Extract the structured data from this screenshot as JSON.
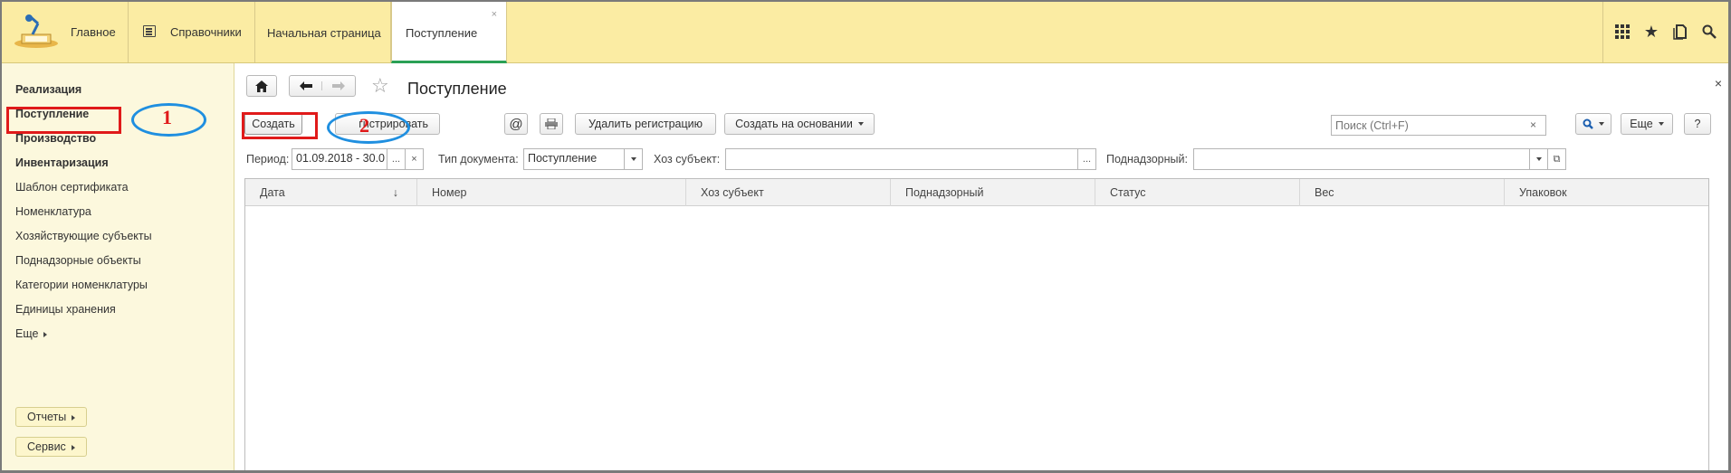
{
  "topbar": {
    "home_label": "Главное",
    "references_label": "Справочники",
    "tabs": [
      {
        "label": "Начальная страница"
      },
      {
        "label": "Поступление",
        "close": "×"
      }
    ]
  },
  "sidebar": {
    "items": [
      {
        "label": "Реализация"
      },
      {
        "label": "Поступление"
      },
      {
        "label": "Производство"
      },
      {
        "label": "Инвентаризация"
      },
      {
        "label": "Шаблон сертификата"
      },
      {
        "label": "Номенклатура"
      },
      {
        "label": "Хозяйствующие субъекты"
      },
      {
        "label": "Поднадзорные объекты"
      },
      {
        "label": "Категории номенклатуры"
      },
      {
        "label": "Единицы хранения"
      },
      {
        "label": "Еще"
      }
    ],
    "reports_label": "Отчеты",
    "service_label": "Сервис"
  },
  "annotations": {
    "one": "1",
    "two": "2"
  },
  "form": {
    "title": "Поступление",
    "close": "×",
    "toolbar": {
      "create": "Создать",
      "register": "гистрировать",
      "email": "@",
      "delete_registration": "Удалить регистрацию",
      "create_based_on": "Создать на основании",
      "search_placeholder": "Поиск (Ctrl+F)",
      "more": "Еще",
      "help": "?"
    },
    "filters": {
      "period_label": "Период:",
      "period_value": "01.09.2018 - 30.0",
      "doc_type_label": "Тип документа:",
      "doc_type_value": "Поступление",
      "subject_label": "Хоз субъект:",
      "subject_value": "",
      "supervised_label": "Поднадзорный:",
      "supervised_value": ""
    },
    "table": {
      "columns": [
        "Дата",
        "Номер",
        "Хоз субъект",
        "Поднадзорный",
        "Статус",
        "Вес",
        "Упаковок"
      ],
      "sort_indicator": "↓",
      "rows": []
    }
  }
}
